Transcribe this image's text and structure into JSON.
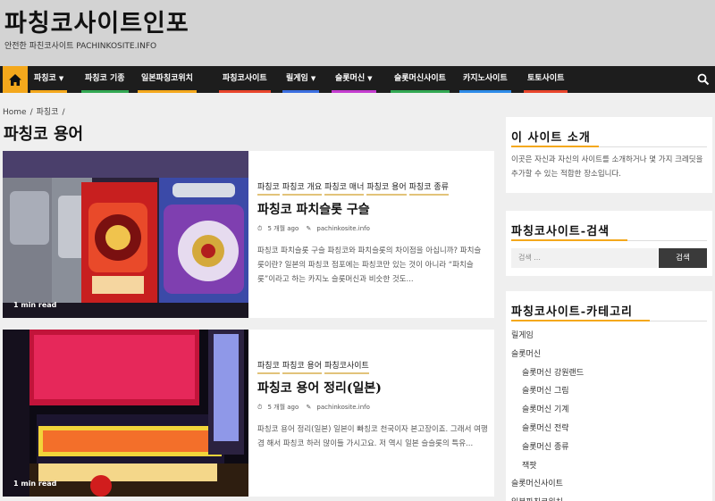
{
  "header": {
    "site_title": "파칭코사이트인포",
    "site_description": "안전한 파친코사이트 PACHINKOSITE.INFO"
  },
  "nav": {
    "items": [
      {
        "label": "파칭코",
        "has_caret": true,
        "color": "#f4a81c"
      },
      {
        "label": "파칭코 기종",
        "has_caret": false,
        "color": "#33a853"
      },
      {
        "label": "일본파칭코위치",
        "has_caret": false,
        "color": "#f4a81c"
      },
      {
        "label": "파칭코사이트",
        "has_caret": false,
        "color": "#e8452c"
      },
      {
        "label": "릴게임",
        "has_caret": true,
        "color": "#3b6fe0"
      },
      {
        "label": "슬롯머신",
        "has_caret": true,
        "color": "#c43ccf"
      },
      {
        "label": "슬롯머신사이트",
        "has_caret": false,
        "color": "#33a853"
      },
      {
        "label": "카지노사이트",
        "has_caret": false,
        "color": "#2d8be8"
      },
      {
        "label": "토토사이트",
        "has_caret": false,
        "color": "#e8452c"
      }
    ],
    "accent": "#f4a81c"
  },
  "breadcrumb": {
    "home": "Home",
    "current": "파칭코"
  },
  "archive_title": "파칭코 용어",
  "posts": [
    {
      "categories": [
        "파칭코",
        "파칭코 개요",
        "파칭코 매너",
        "파칭코 용어",
        "파칭코 종류"
      ],
      "title": "파칭코 파치슬롯 구슬",
      "date": "5 개월 ago",
      "author": "pachinkosite.info",
      "excerpt": "파칭코 파치슬롯 구슬 파칭코와 파치슬롯의 차이점을 아십니까? 파치슬롯이란? 일본의 파칭코 점포에는 파칭코만 있는 것이 아니라 “파치슬롯”이라고 하는 카지노 슬롯머신과 비슷한 것도...",
      "read_time": "1 min read"
    },
    {
      "categories": [
        "파칭코",
        "파칭코 용어",
        "파칭코사이트"
      ],
      "title": "파칭코 용어 정리(일본)",
      "date": "5 개월 ago",
      "author": "pachinkosite.info",
      "excerpt": "파칭코 용어 정리(일본) 일본이 빠칭코 천국이자 본고장이죠. 그래서 여행 겸 해서 파칭코 하러 많이들 가시고요. 저 역시 일본 슬슬롯의 특유...",
      "read_time": "1 min read"
    }
  ],
  "sidebar": {
    "about": {
      "title": "이 사이트 소개",
      "text": "이곳은 자신과 자신의 사이트를 소개하거나 몇 가지 크레딧을 추가할 수 있는 적합한 장소입니다."
    },
    "search": {
      "title": "파칭코사이트-검색",
      "placeholder": "검색 ...",
      "button": "검색"
    },
    "categories": {
      "title": "파칭코사이트-카테고리",
      "items": [
        {
          "label": "릴게임",
          "child": false
        },
        {
          "label": "슬롯머신",
          "child": false
        },
        {
          "label": "슬롯머신 강원랜드",
          "child": true
        },
        {
          "label": "슬롯머신 그림",
          "child": true
        },
        {
          "label": "슬롯머신 기계",
          "child": true
        },
        {
          "label": "슬롯머신 전략",
          "child": true
        },
        {
          "label": "슬롯머신 종류",
          "child": true
        },
        {
          "label": "잭팟",
          "child": true
        },
        {
          "label": "슬롯머신사이트",
          "child": false
        },
        {
          "label": "일본파칭코위치",
          "child": false
        }
      ]
    }
  }
}
